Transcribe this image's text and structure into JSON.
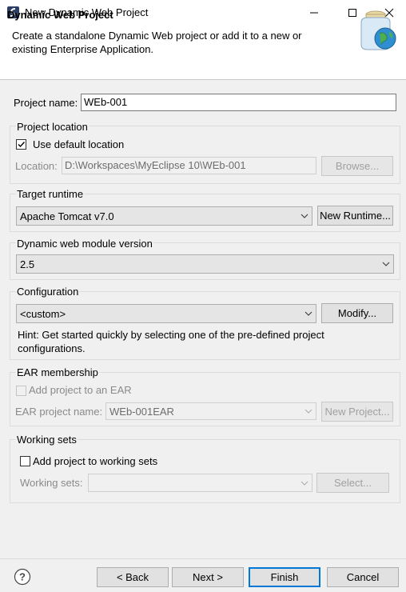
{
  "window": {
    "title": "New Dynamic Web Project",
    "minimize_icon": "minimize-icon",
    "maximize_icon": "maximize-icon",
    "close_icon": "close-icon"
  },
  "banner": {
    "title": "Dynamic Web Project",
    "description": "Create a standalone Dynamic Web project or add it to a new or existing Enterprise Application."
  },
  "project_name": {
    "label": "Project name:",
    "value": "WEb-001"
  },
  "project_location": {
    "group_label": "Project location",
    "use_default_label": "Use default location",
    "use_default_checked": true,
    "location_label": "Location:",
    "location_value": "D:\\Workspaces\\MyEclipse 10\\WEb-001",
    "browse_label": "Browse..."
  },
  "target_runtime": {
    "group_label": "Target runtime",
    "selected": "Apache Tomcat v7.0",
    "new_runtime_label": "New Runtime..."
  },
  "module_version": {
    "group_label": "Dynamic web module version",
    "selected": "2.5"
  },
  "configuration": {
    "group_label": "Configuration",
    "selected": "<custom>",
    "modify_label": "Modify...",
    "hint": "Hint: Get started quickly by selecting one of the pre-defined project configurations."
  },
  "ear": {
    "group_label": "EAR membership",
    "add_label": "Add project to an EAR",
    "add_checked": false,
    "project_name_label": "EAR project name:",
    "project_name_value": "WEb-001EAR",
    "new_project_label": "New Project..."
  },
  "working_sets": {
    "group_label": "Working sets",
    "add_label": "Add project to working sets",
    "add_checked": false,
    "sets_label": "Working sets:",
    "sets_value": "",
    "select_label": "Select..."
  },
  "footer": {
    "help_icon": "help-icon",
    "back_label": "< Back",
    "next_label": "Next >",
    "finish_label": "Finish",
    "cancel_label": "Cancel"
  },
  "colors": {
    "accent": "#0078d7",
    "background": "#f0f0f0"
  }
}
